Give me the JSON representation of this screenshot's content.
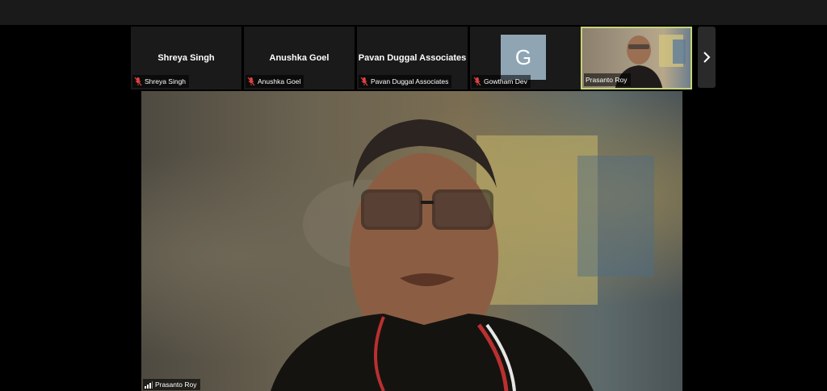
{
  "participants": [
    {
      "display_name": "Shreya Singh",
      "chip_label": "Shreya Singh",
      "muted": true
    },
    {
      "display_name": "Anushka Goel",
      "chip_label": "Anushka Goel",
      "muted": true
    },
    {
      "display_name": "Pavan Duggal Associates",
      "chip_label": "Pavan Duggal Associates",
      "muted": true
    },
    {
      "avatar_letter": "G",
      "chip_label": "Gowtham Dev",
      "muted": true,
      "avatar_color": "#8fa5b4"
    },
    {
      "chip_label": "Prasanto Roy",
      "video_on": true,
      "active_speaker": true
    }
  ],
  "next_page_icon": "chevron-right-icon",
  "main_speaker": {
    "name": "Prasanto Roy"
  },
  "colors": {
    "active_border": "#c6d27a",
    "muted_mic": "#e04343"
  }
}
